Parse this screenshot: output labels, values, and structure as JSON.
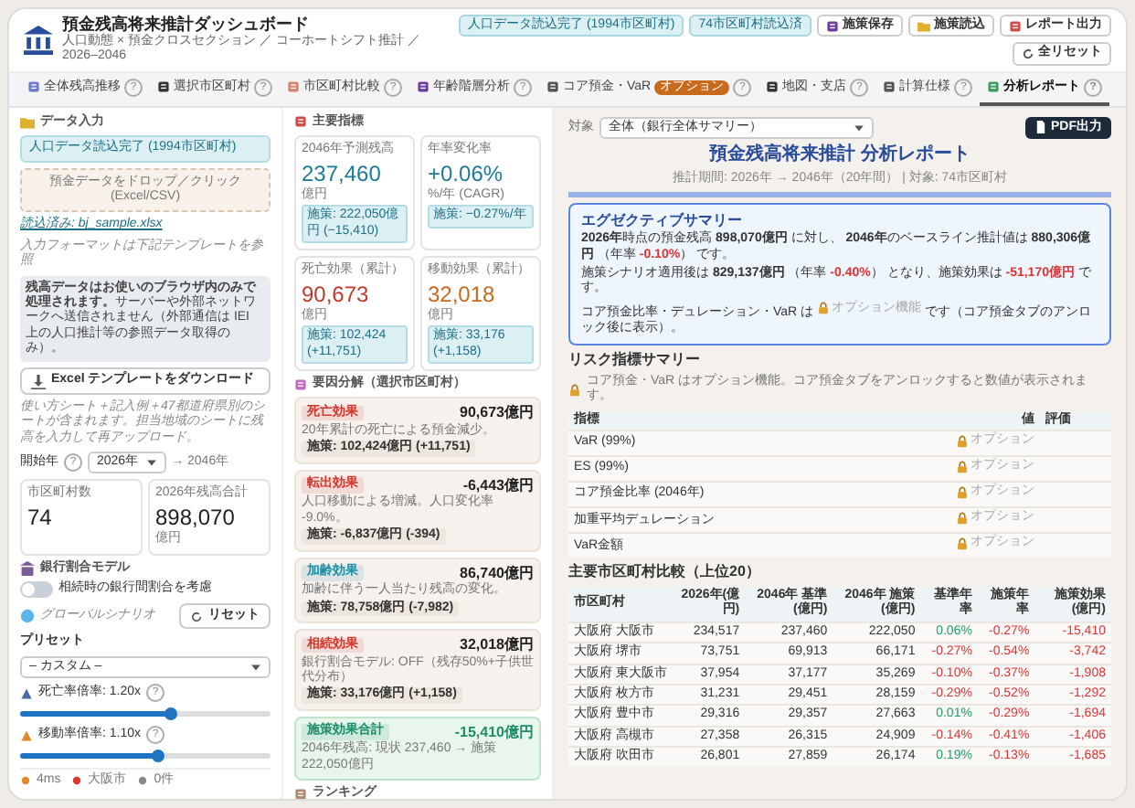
{
  "header": {
    "title": "預金残高将来推計ダッシュボード",
    "subtitle": "人口動態 × 預金クロスセクション ／ コーホートシフト推計 ／ 2026–2046",
    "status_badges": [
      "人口データ読込完了 (1994市区町村)",
      "74市区町村読込済"
    ],
    "buttons": [
      "施策保存",
      "施策読込",
      "レポート出力",
      "全リセット"
    ]
  },
  "tabs": [
    {
      "label": "全体残高推移",
      "help": "?",
      "selected": false
    },
    {
      "label": "選択市区町村",
      "help": "?",
      "selected": false
    },
    {
      "label": "市区町村比較",
      "help": "?",
      "selected": false
    },
    {
      "label": "年齢階層分析",
      "help": "?",
      "selected": false
    },
    {
      "label": "コア預金・VaR",
      "badge": "オプション",
      "help": "?",
      "selected": false
    },
    {
      "label": "地図・支店",
      "help": "?",
      "selected": false
    },
    {
      "label": "計算仕様",
      "help": "?",
      "selected": false
    },
    {
      "label": "分析レポート",
      "help": "?",
      "selected": true
    }
  ],
  "sidebar": {
    "data_input": {
      "title": "データ入力",
      "status": "人口データ読込完了 (1994市区町村)",
      "dropzone": "預金データをドロップ／クリック (Excel/CSV)",
      "loaded": "読込済み: bj_sample.xlsx",
      "format_note": "入力フォーマットは下記テンプレートを参照",
      "privacy_notice": "**残高データはお使いのブラウザ内のみで処理されます。**サーバーや外部ネットワークへ送信されません（外部通信は IEI 上の人口推計等の参照データ取得のみ）。",
      "template_button": "Excel テンプレートをダウンロード",
      "template_note": "使い方シート＋記入例＋47都道府県別のシートが含まれます。担当地域のシートに残高を入力して再アップロード。"
    },
    "start_year": {
      "label": "開始年",
      "help": "?",
      "value": "2026年",
      "end": "→ 2046年"
    },
    "stats": [
      {
        "label": "市区町村数",
        "value": "74"
      },
      {
        "label": "2026年残高合計",
        "value": "898,070",
        "unit": "億円"
      }
    ],
    "bank_share": {
      "title": "銀行割合モデル",
      "toggle_label": "相続時の銀行間割合を考慮",
      "on": false
    },
    "scenario": {
      "title": "グローバルシナリオ",
      "reset": "リセット",
      "preset_label": "プリセット",
      "preset": "– カスタム –",
      "sliders": [
        {
          "label": "死亡率倍率: 1.20x",
          "help": "?",
          "level": 0.6
        },
        {
          "label": "移動率倍率: 1.10x",
          "help": "?",
          "level": 0.55
        }
      ]
    },
    "footer": [
      "4ms",
      "大阪市",
      "0件"
    ]
  },
  "indicators": {
    "title": "主要指標",
    "cards": [
      {
        "label": "2046年予測残高",
        "value": "237,460",
        "unit": "億円",
        "policy": "施策: 222,050億円 (−15,410)",
        "color": "#1c7a99"
      },
      {
        "label": "年率変化率",
        "value": "+0.06%",
        "unit": "%/年 (CAGR)",
        "policy": "施策: −0.27%/年",
        "color": "#1c7a99"
      },
      {
        "label": "死亡効果（累計）",
        "value": "90,673",
        "unit": "億円",
        "policy": "施策: 102,424 (+11,751)",
        "color": "#c0392b"
      },
      {
        "label": "移動効果（累計）",
        "value": "32,018",
        "unit": "億円",
        "policy": "施策: 33,176 (+1,158)",
        "color": "#c8691c"
      }
    ]
  },
  "factors": {
    "title": "要因分解（選択市区町村）",
    "items": [
      {
        "kind": "factor",
        "tag": "死亡効果",
        "amount": "90,673億円",
        "desc": "20年累計の死亡による預金減少。",
        "policy": "施策: 102,424億円 (+11,751)",
        "color": "#d0392f"
      },
      {
        "kind": "factor",
        "tag": "転出効果",
        "amount": "-6,443億円",
        "desc": "人口移動による増減。人口変化率 -9.0%。",
        "policy": "施策: -6,837億円 (-394)",
        "color": "#d0392f"
      },
      {
        "kind": "factor",
        "tag": "加齢効果",
        "amount": "86,740億円",
        "desc": "加齢に伴う一人当たり残高の変化。",
        "policy": "施策: 78,758億円 (-7,982)",
        "color": "#1f8fa8"
      },
      {
        "kind": "factor",
        "tag": "相続効果",
        "amount": "32,018億円",
        "desc": "銀行割合モデル: OFF（残存50%+子供世代分布）",
        "policy": "施策: 33,176億円 (+1,158)",
        "color": "#d0392f"
      },
      {
        "kind": "total",
        "tag": "施策効果合計",
        "amount": "-15,410億円",
        "desc": "2046年残高: 現状 237,460 → 施策 222,050億円",
        "color": "#1f8f6a"
      }
    ]
  },
  "ranking": {
    "title": "ランキング"
  },
  "report": {
    "target_label": "対象",
    "target": "全体（銀行全体サマリー）",
    "pdf_button": "PDF出力",
    "title": "預金残高将来推計 分析レポート",
    "period": "推計期間: 2026年 → 2046年（20年間） | 対象: 74市区町村",
    "summary": {
      "title": "エグゼクティブサマリー",
      "lines": [
        [
          {
            "kind": "bold",
            "text": "2026年"
          },
          {
            "kind": "plain",
            "text": "時点の預金残高 "
          },
          {
            "kind": "bold",
            "text": "898,070億円"
          },
          {
            "kind": "plain",
            "text": " に対し、 "
          },
          {
            "kind": "bold",
            "text": "2046年"
          },
          {
            "kind": "plain",
            "text": "のベースライン推計値は "
          },
          {
            "kind": "bold",
            "text": "880,306億円"
          },
          {
            "kind": "plain",
            "text": " （年率 "
          },
          {
            "kind": "neg",
            "text": "-0.10%"
          },
          {
            "kind": "plain",
            "text": "） です。"
          }
        ],
        [
          {
            "kind": "plain",
            "text": "施策シナリオ適用後は "
          },
          {
            "kind": "bold",
            "text": "829,137億円"
          },
          {
            "kind": "plain",
            "text": " （年率 "
          },
          {
            "kind": "neg",
            "text": "-0.40%"
          },
          {
            "kind": "plain",
            "text": "） となり、施策効果は "
          },
          {
            "kind": "neg",
            "text": "-51,170億円"
          },
          {
            "kind": "plain",
            "text": " です。"
          }
        ],
        [
          {
            "kind": "plain",
            "text": "コア預金比率・デュレーション・VaR は "
          },
          {
            "kind": "locked",
            "text": "オプション機能"
          },
          {
            "kind": "plain",
            "text": " です（コア預金タブのアンロック後に表示）。"
          }
        ]
      ]
    },
    "risk": {
      "title": "リスク指標サマリー",
      "note": "コア預金・VaR はオプション機能。コア預金タブをアンロックすると数値が表示されます。",
      "columns": [
        "指標",
        "値",
        "評価"
      ],
      "rows": [
        {
          "name": "VaR (99%)",
          "value": "オプション"
        },
        {
          "name": "ES (99%)",
          "value": "オプション"
        },
        {
          "name": "コア預金比率 (2046年)",
          "value": "オプション"
        },
        {
          "name": "加重平均デュレーション",
          "value": "オプション"
        },
        {
          "name": "VaR金額",
          "value": "オプション"
        }
      ]
    },
    "comparison": {
      "title": "主要市区町村比較（上位20）",
      "columns": [
        "市区町村",
        "2026年(億円)",
        "2046年 基準(億円)",
        "2046年 施策(億円)",
        "基準年率",
        "施策年率",
        "施策効果(億円)"
      ],
      "rows": [
        [
          "大阪府 大阪市",
          "234,517",
          "237,460",
          "222,050",
          "0.06%",
          "-0.27%",
          "-15,410"
        ],
        [
          "大阪府 堺市",
          "73,751",
          "69,913",
          "66,171",
          "-0.27%",
          "-0.54%",
          "-3,742"
        ],
        [
          "大阪府 東大阪市",
          "37,954",
          "37,177",
          "35,269",
          "-0.10%",
          "-0.37%",
          "-1,908"
        ],
        [
          "大阪府 枚方市",
          "31,231",
          "29,451",
          "28,159",
          "-0.29%",
          "-0.52%",
          "-1,292"
        ],
        [
          "大阪府 豊中市",
          "29,316",
          "29,357",
          "27,663",
          "0.01%",
          "-0.29%",
          "-1,694"
        ],
        [
          "大阪府 高槻市",
          "27,358",
          "26,315",
          "24,909",
          "-0.14%",
          "-0.41%",
          "-1,406"
        ],
        [
          "大阪府 吹田市",
          "26,801",
          "27,859",
          "26,174",
          "0.19%",
          "-0.13%",
          "-1,685"
        ]
      ]
    }
  }
}
